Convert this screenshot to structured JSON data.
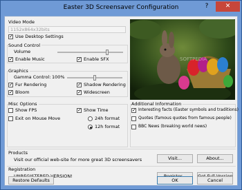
{
  "window": {
    "title": "Easter 3D Screensaver Configuration",
    "help": "?",
    "close": "✕"
  },
  "video": {
    "title": "Video Mode",
    "mode_value": "1152x864x32bits",
    "use_desktop": "Use Desktop Settings"
  },
  "sound": {
    "title": "Sound Control",
    "volume": "Volume",
    "volume_level": 0.78,
    "enable_music": "Enable Music",
    "enable_sfx": "Enable SFX"
  },
  "graphics": {
    "title": "Graphics",
    "gamma_label": "Gamma Control:",
    "gamma_value": "100%",
    "gamma_level": 0.5,
    "fur": "Fur Rendering",
    "shadow": "Shadow Rendering",
    "bloom": "Bloom",
    "widescreen": "Widescreen"
  },
  "misc": {
    "title": "Misc Options",
    "show_fps": "Show FPS",
    "exit_mouse": "Exit on Mouse Move",
    "show_time": "Show Time",
    "h24": "24h format",
    "h12": "12h format"
  },
  "additional": {
    "title": "Additional Information",
    "facts": "Interesting facts (Easter symbols and traditions)",
    "quotes": "Quotes (famous quotes from famous people)",
    "bbc": "BBC News (breaking world news)"
  },
  "products": {
    "title": "Products",
    "text": "Visit our official web-site for more great 3D screensavers",
    "visit": "Visit...",
    "about": "About..."
  },
  "registration": {
    "title": "Registration",
    "text": "UNREGISTERED VERSION!",
    "register": "Register...",
    "get_full": "Get Full Version"
  },
  "footer": {
    "restore": "Restore Defaults",
    "ok": "OK",
    "cancel": "Cancel"
  },
  "preview": {
    "watermark": "SOFTPEDIA"
  },
  "colors": {
    "titlebar": "#6f9ad6",
    "close": "#c7463a",
    "dialog": "#f0f0f0"
  }
}
